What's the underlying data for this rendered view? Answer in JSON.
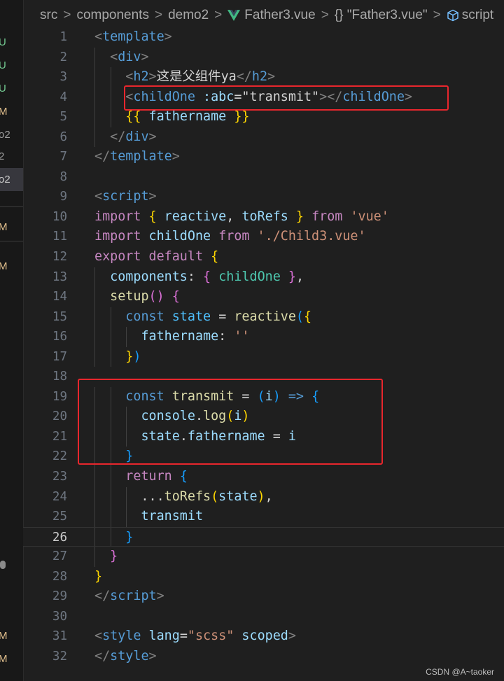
{
  "breadcrumb": {
    "items": [
      "src",
      "components",
      "demo2",
      "Father3.vue",
      "{} \"Father3.vue\"",
      "script"
    ],
    "separator": ">"
  },
  "gutter_markers": [
    "U",
    "U",
    "U",
    "M",
    "o2",
    "2",
    "o2",
    "M",
    "M",
    "M",
    "M"
  ],
  "current_line": 26,
  "code_lines": [
    {
      "n": "1",
      "tokens": [
        [
          "ang",
          "<"
        ],
        [
          "tag",
          "template"
        ],
        [
          "ang",
          ">"
        ]
      ]
    },
    {
      "n": "2",
      "tokens": [
        [
          "plain",
          "  "
        ],
        [
          "ang",
          "<"
        ],
        [
          "tag",
          "div"
        ],
        [
          "ang",
          ">"
        ]
      ]
    },
    {
      "n": "3",
      "tokens": [
        [
          "plain",
          "    "
        ],
        [
          "ang",
          "<"
        ],
        [
          "tag",
          "h2"
        ],
        [
          "ang",
          ">"
        ],
        [
          "plain",
          "这是父组件ya"
        ],
        [
          "ang",
          "</"
        ],
        [
          "tag",
          "h2"
        ],
        [
          "ang",
          ">"
        ]
      ]
    },
    {
      "n": "4",
      "tokens": [
        [
          "plain",
          "    "
        ],
        [
          "ang",
          "<"
        ],
        [
          "tag",
          "childOne"
        ],
        [
          "plain",
          " "
        ],
        [
          "attr",
          ":abc"
        ],
        [
          "plain",
          "=\"transmit\""
        ],
        [
          "ang",
          "></"
        ],
        [
          "tag",
          "childOne"
        ],
        [
          "ang",
          ">"
        ]
      ]
    },
    {
      "n": "5",
      "tokens": [
        [
          "plain",
          "    "
        ],
        [
          "b1",
          "{{"
        ],
        [
          "plain",
          " "
        ],
        [
          "var",
          "fathername"
        ],
        [
          "plain",
          " "
        ],
        [
          "b1",
          "}}"
        ]
      ]
    },
    {
      "n": "6",
      "tokens": [
        [
          "plain",
          "  "
        ],
        [
          "ang",
          "</"
        ],
        [
          "tag",
          "div"
        ],
        [
          "ang",
          ">"
        ]
      ]
    },
    {
      "n": "7",
      "tokens": [
        [
          "ang",
          "</"
        ],
        [
          "tag",
          "template"
        ],
        [
          "ang",
          ">"
        ]
      ]
    },
    {
      "n": "8",
      "tokens": []
    },
    {
      "n": "9",
      "tokens": [
        [
          "ang",
          "<"
        ],
        [
          "tag",
          "script"
        ],
        [
          "ang",
          ">"
        ]
      ]
    },
    {
      "n": "10",
      "tokens": [
        [
          "ctl",
          "import"
        ],
        [
          "plain",
          " "
        ],
        [
          "b1",
          "{"
        ],
        [
          "plain",
          " "
        ],
        [
          "var",
          "reactive"
        ],
        [
          "plain",
          ", "
        ],
        [
          "var",
          "toRefs"
        ],
        [
          "plain",
          " "
        ],
        [
          "b1",
          "}"
        ],
        [
          "plain",
          " "
        ],
        [
          "ctl",
          "from"
        ],
        [
          "plain",
          " "
        ],
        [
          "str",
          "'vue'"
        ]
      ]
    },
    {
      "n": "11",
      "tokens": [
        [
          "ctl",
          "import"
        ],
        [
          "plain",
          " "
        ],
        [
          "var",
          "childOne"
        ],
        [
          "plain",
          " "
        ],
        [
          "ctl",
          "from"
        ],
        [
          "plain",
          " "
        ],
        [
          "str",
          "'./Child3.vue'"
        ]
      ]
    },
    {
      "n": "12",
      "tokens": [
        [
          "ctl",
          "export"
        ],
        [
          "plain",
          " "
        ],
        [
          "ctl",
          "default"
        ],
        [
          "plain",
          " "
        ],
        [
          "b1",
          "{"
        ]
      ]
    },
    {
      "n": "13",
      "tokens": [
        [
          "plain",
          "  "
        ],
        [
          "var",
          "components"
        ],
        [
          "plain",
          ": "
        ],
        [
          "b2",
          "{"
        ],
        [
          "plain",
          " "
        ],
        [
          "comp",
          "childOne"
        ],
        [
          "plain",
          " "
        ],
        [
          "b2",
          "}"
        ],
        [
          "plain",
          ","
        ]
      ]
    },
    {
      "n": "14",
      "tokens": [
        [
          "plain",
          "  "
        ],
        [
          "fn",
          "setup"
        ],
        [
          "b2",
          "()"
        ],
        [
          "plain",
          " "
        ],
        [
          "b2",
          "{"
        ]
      ]
    },
    {
      "n": "15",
      "tokens": [
        [
          "plain",
          "    "
        ],
        [
          "kw",
          "const"
        ],
        [
          "plain",
          " "
        ],
        [
          "cons",
          "state"
        ],
        [
          "plain",
          " = "
        ],
        [
          "fn",
          "reactive"
        ],
        [
          "b3",
          "("
        ],
        [
          "b1",
          "{"
        ]
      ]
    },
    {
      "n": "16",
      "tokens": [
        [
          "plain",
          "      "
        ],
        [
          "var",
          "fathername"
        ],
        [
          "plain",
          ": "
        ],
        [
          "str",
          "''"
        ]
      ]
    },
    {
      "n": "17",
      "tokens": [
        [
          "plain",
          "    "
        ],
        [
          "b1",
          "}"
        ],
        [
          "b3",
          ")"
        ]
      ]
    },
    {
      "n": "18",
      "tokens": []
    },
    {
      "n": "19",
      "tokens": [
        [
          "plain",
          "    "
        ],
        [
          "kw",
          "const"
        ],
        [
          "plain",
          " "
        ],
        [
          "fn",
          "transmit"
        ],
        [
          "plain",
          " = "
        ],
        [
          "b3",
          "("
        ],
        [
          "var",
          "i"
        ],
        [
          "b3",
          ")"
        ],
        [
          "plain",
          " "
        ],
        [
          "kw",
          "=>"
        ],
        [
          "plain",
          " "
        ],
        [
          "b3",
          "{"
        ]
      ]
    },
    {
      "n": "20",
      "tokens": [
        [
          "plain",
          "      "
        ],
        [
          "var",
          "console"
        ],
        [
          "plain",
          "."
        ],
        [
          "fn",
          "log"
        ],
        [
          "b1",
          "("
        ],
        [
          "var",
          "i"
        ],
        [
          "b1",
          ")"
        ]
      ]
    },
    {
      "n": "21",
      "tokens": [
        [
          "plain",
          "      "
        ],
        [
          "var",
          "state"
        ],
        [
          "plain",
          "."
        ],
        [
          "var",
          "fathername"
        ],
        [
          "plain",
          " = "
        ],
        [
          "var",
          "i"
        ]
      ]
    },
    {
      "n": "22",
      "tokens": [
        [
          "plain",
          "    "
        ],
        [
          "b3",
          "}"
        ]
      ]
    },
    {
      "n": "23",
      "tokens": [
        [
          "plain",
          "    "
        ],
        [
          "ctl",
          "return"
        ],
        [
          "plain",
          " "
        ],
        [
          "b3",
          "{"
        ]
      ]
    },
    {
      "n": "24",
      "tokens": [
        [
          "plain",
          "      ..."
        ],
        [
          "fn",
          "toRefs"
        ],
        [
          "b1",
          "("
        ],
        [
          "var",
          "state"
        ],
        [
          "b1",
          ")"
        ],
        [
          "plain",
          ","
        ]
      ]
    },
    {
      "n": "25",
      "tokens": [
        [
          "plain",
          "      "
        ],
        [
          "var",
          "transmit"
        ]
      ]
    },
    {
      "n": "26",
      "tokens": [
        [
          "plain",
          "    "
        ],
        [
          "b3",
          "}"
        ]
      ]
    },
    {
      "n": "27",
      "tokens": [
        [
          "plain",
          "  "
        ],
        [
          "b2",
          "}"
        ]
      ]
    },
    {
      "n": "28",
      "tokens": [
        [
          "b1",
          "}"
        ]
      ]
    },
    {
      "n": "29",
      "tokens": [
        [
          "ang",
          "</"
        ],
        [
          "tag",
          "script"
        ],
        [
          "ang",
          ">"
        ]
      ]
    },
    {
      "n": "30",
      "tokens": []
    },
    {
      "n": "31",
      "tokens": [
        [
          "ang",
          "<"
        ],
        [
          "tag",
          "style"
        ],
        [
          "plain",
          " "
        ],
        [
          "attr",
          "lang"
        ],
        [
          "plain",
          "="
        ],
        [
          "str",
          "\"scss\""
        ],
        [
          "plain",
          " "
        ],
        [
          "attr",
          "scoped"
        ],
        [
          "ang",
          ">"
        ]
      ]
    },
    {
      "n": "32",
      "tokens": [
        [
          "ang",
          "</"
        ],
        [
          "tag",
          "style"
        ],
        [
          "ang",
          ">"
        ]
      ]
    }
  ],
  "watermark": "CSDN @A~taoker",
  "colors": {
    "background": "#1f1f1f",
    "annotation_box": "#e8262d",
    "git_untracked": "#73c991",
    "git_modified": "#e2c08d"
  }
}
